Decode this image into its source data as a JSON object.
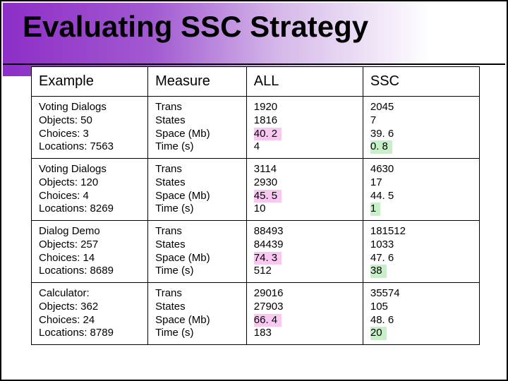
{
  "title": "Evaluating SSC Strategy",
  "headers": {
    "c1": "Example",
    "c2": "Measure",
    "c3": "ALL",
    "c4": "SSC"
  },
  "measure_labels": [
    "Trans",
    "States",
    "Space (Mb)",
    "Time (s)"
  ],
  "rows": [
    {
      "example": [
        "Voting Dialogs",
        "Objects: 50",
        "Choices: 3",
        "Locations: 7563"
      ],
      "all": [
        "1920",
        "1816",
        "40. 2",
        "4"
      ],
      "ssc": [
        "2045",
        "7",
        "39. 6",
        "0. 8"
      ],
      "all_hl": [
        null,
        null,
        "pink",
        null
      ],
      "ssc_hl": [
        null,
        null,
        null,
        "green"
      ]
    },
    {
      "example": [
        "Voting Dialogs",
        "Objects: 120",
        "Choices: 4",
        "Locations: 8269"
      ],
      "all": [
        "3114",
        "2930",
        "45. 5",
        "10"
      ],
      "ssc": [
        "4630",
        "17",
        "44. 5",
        "1"
      ],
      "all_hl": [
        null,
        null,
        "pink",
        null
      ],
      "ssc_hl": [
        null,
        null,
        null,
        "green"
      ]
    },
    {
      "example": [
        "Dialog Demo",
        "Objects: 257",
        "Choices: 14",
        "Locations: 8689"
      ],
      "all": [
        "88493",
        "84439",
        "74. 3",
        "512"
      ],
      "ssc": [
        "181512",
        "1033",
        "47. 6",
        "38"
      ],
      "all_hl": [
        null,
        null,
        "pink",
        null
      ],
      "ssc_hl": [
        null,
        null,
        null,
        "green"
      ]
    },
    {
      "example": [
        "Calculator:",
        "Objects: 362",
        "Choices: 24",
        "Locations: 8789"
      ],
      "all": [
        "29016",
        "27903",
        "66. 4",
        "183"
      ],
      "ssc": [
        "35574",
        "105",
        "48. 6",
        "20"
      ],
      "all_hl": [
        null,
        null,
        "pink",
        null
      ],
      "ssc_hl": [
        null,
        null,
        null,
        "green"
      ]
    }
  ],
  "chart_data": {
    "type": "table",
    "title": "Evaluating SSC Strategy",
    "columns": [
      "Example",
      "Measure",
      "ALL",
      "SSC"
    ],
    "metrics": [
      "Trans",
      "States",
      "Space (Mb)",
      "Time (s)"
    ],
    "records": [
      {
        "example": "Voting Dialogs / Objects 50 / Choices 3 / Locations 7563",
        "ALL": {
          "Trans": 1920,
          "States": 1816,
          "Space_Mb": 40.2,
          "Time_s": 4
        },
        "SSC": {
          "Trans": 2045,
          "States": 7,
          "Space_Mb": 39.6,
          "Time_s": 0.8
        }
      },
      {
        "example": "Voting Dialogs / Objects 120 / Choices 4 / Locations 8269",
        "ALL": {
          "Trans": 3114,
          "States": 2930,
          "Space_Mb": 45.5,
          "Time_s": 10
        },
        "SSC": {
          "Trans": 4630,
          "States": 17,
          "Space_Mb": 44.5,
          "Time_s": 1
        }
      },
      {
        "example": "Dialog Demo / Objects 257 / Choices 14 / Locations 8689",
        "ALL": {
          "Trans": 88493,
          "States": 84439,
          "Space_Mb": 74.3,
          "Time_s": 512
        },
        "SSC": {
          "Trans": 181512,
          "States": 1033,
          "Space_Mb": 47.6,
          "Time_s": 38
        }
      },
      {
        "example": "Calculator / Objects 362 / Choices 24 / Locations 8789",
        "ALL": {
          "Trans": 29016,
          "States": 27903,
          "Space_Mb": 66.4,
          "Time_s": 183
        },
        "SSC": {
          "Trans": 35574,
          "States": 105,
          "Space_Mb": 48.6,
          "Time_s": 20
        }
      }
    ]
  }
}
